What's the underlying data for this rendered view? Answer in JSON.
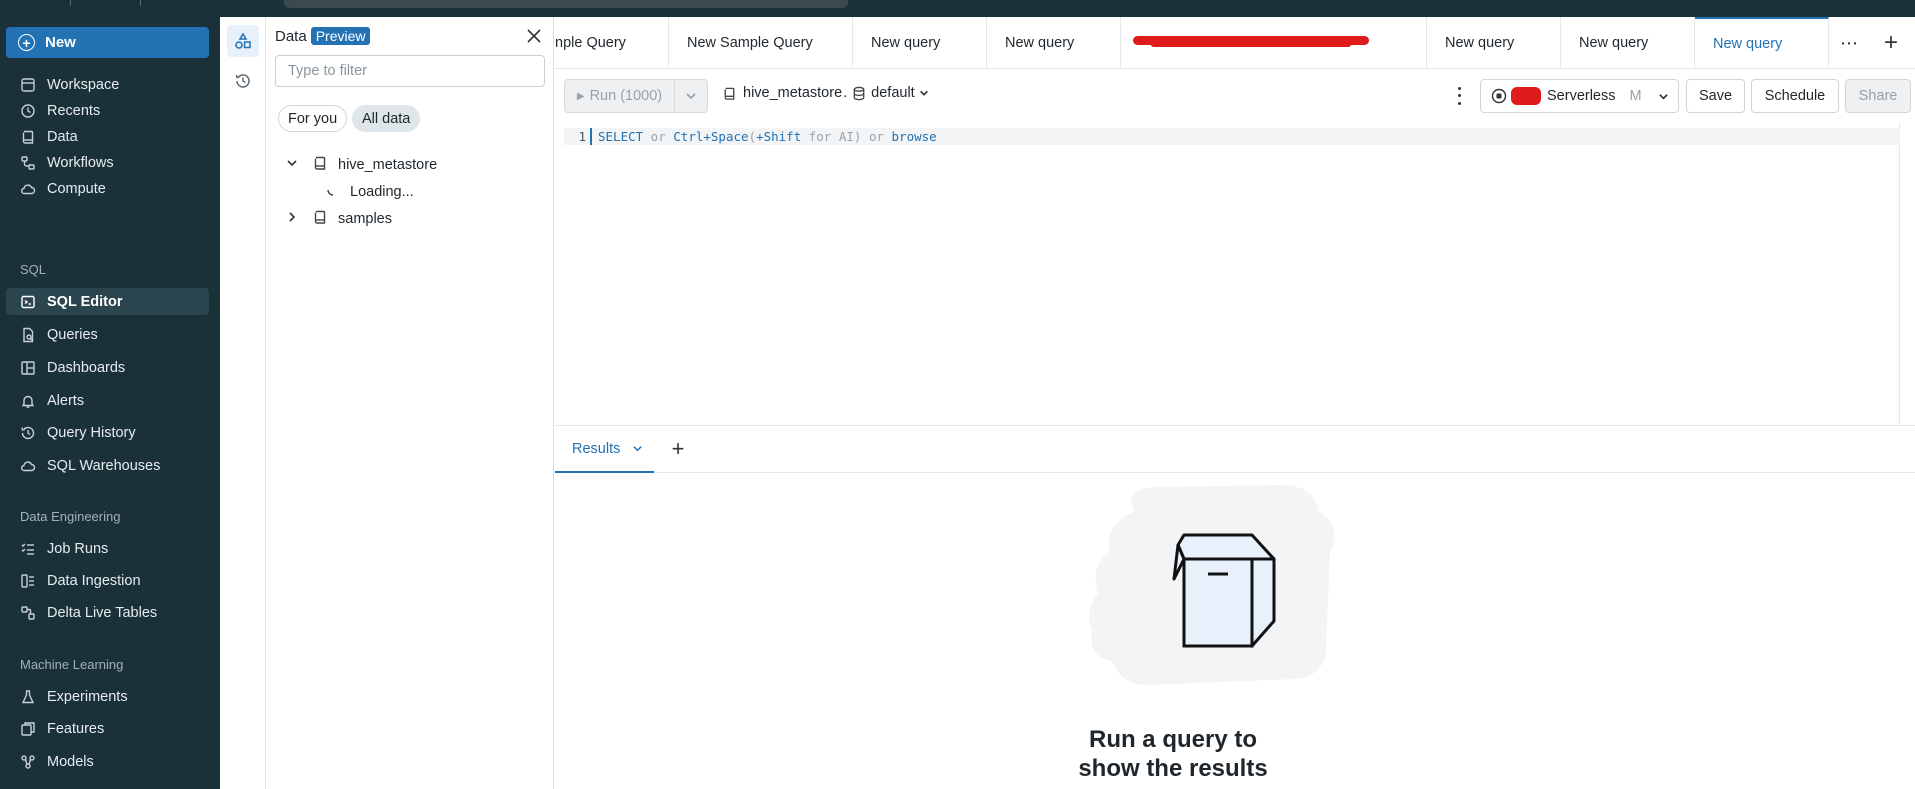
{
  "sidebar": {
    "new_label": "New",
    "items_top": [
      {
        "label": "Workspace",
        "icon": "workspace-icon"
      },
      {
        "label": "Recents",
        "icon": "clock-icon"
      },
      {
        "label": "Data",
        "icon": "database-icon"
      },
      {
        "label": "Workflows",
        "icon": "workflows-icon"
      },
      {
        "label": "Compute",
        "icon": "cloud-icon"
      }
    ],
    "section_sql": "SQL",
    "items_sql": [
      {
        "label": "SQL Editor",
        "icon": "sql-editor-icon",
        "active": true
      },
      {
        "label": "Queries",
        "icon": "query-file-icon"
      },
      {
        "label": "Dashboards",
        "icon": "dashboard-icon"
      },
      {
        "label": "Alerts",
        "icon": "bell-icon"
      },
      {
        "label": "Query History",
        "icon": "history-icon"
      },
      {
        "label": "SQL Warehouses",
        "icon": "cloud-icon"
      }
    ],
    "section_de": "Data Engineering",
    "items_de": [
      {
        "label": "Job Runs",
        "icon": "list-check-icon"
      },
      {
        "label": "Data Ingestion",
        "icon": "ingestion-icon"
      },
      {
        "label": "Delta Live Tables",
        "icon": "pipeline-icon"
      }
    ],
    "section_ml": "Machine Learning",
    "items_ml": [
      {
        "label": "Experiments",
        "icon": "flask-icon"
      },
      {
        "label": "Features",
        "icon": "features-icon"
      },
      {
        "label": "Models",
        "icon": "models-icon"
      }
    ]
  },
  "data_panel": {
    "title": "Data",
    "badge": "Preview",
    "filter_placeholder": "Type to filter",
    "pills": [
      "For you",
      "All data"
    ],
    "selected_pill": "All data",
    "tree": [
      {
        "label": "hive_metastore",
        "expanded": true
      },
      {
        "label": "Loading...",
        "loading": true
      },
      {
        "label": "samples",
        "expanded": false
      }
    ]
  },
  "tabs": [
    {
      "label": "nple Query"
    },
    {
      "label": "New Sample Query"
    },
    {
      "label": "New query"
    },
    {
      "label": "New query"
    },
    {
      "label": "",
      "redacted": true
    },
    {
      "label": "New query"
    },
    {
      "label": "New query"
    },
    {
      "label": "New query",
      "active": true
    }
  ],
  "toolbar": {
    "run_label": "Run (1000)",
    "catalog": "hive_metastore",
    "catalog_sep": ".",
    "schema": "default",
    "warehouse_name": "Serverless",
    "warehouse_size": "M",
    "save_label": "Save",
    "schedule_label": "Schedule",
    "share_label": "Share"
  },
  "editor": {
    "line_number": "1",
    "tokens": [
      {
        "text": "SELECT",
        "kind": "kw"
      },
      {
        "text": " or ",
        "kind": "hint"
      },
      {
        "text": "Ctrl+Space",
        "kind": "kw"
      },
      {
        "text": "(",
        "kind": "hint"
      },
      {
        "text": "+Shift",
        "kind": "kw"
      },
      {
        "text": " for AI) or ",
        "kind": "hint"
      },
      {
        "text": "browse",
        "kind": "kw"
      }
    ]
  },
  "results": {
    "tab_label": "Results",
    "empty_message": "Run a query to show the results"
  },
  "colors": {
    "sidebar_bg": "#1b3139",
    "accent": "#2272b4",
    "redaction": "#e01b1b"
  }
}
